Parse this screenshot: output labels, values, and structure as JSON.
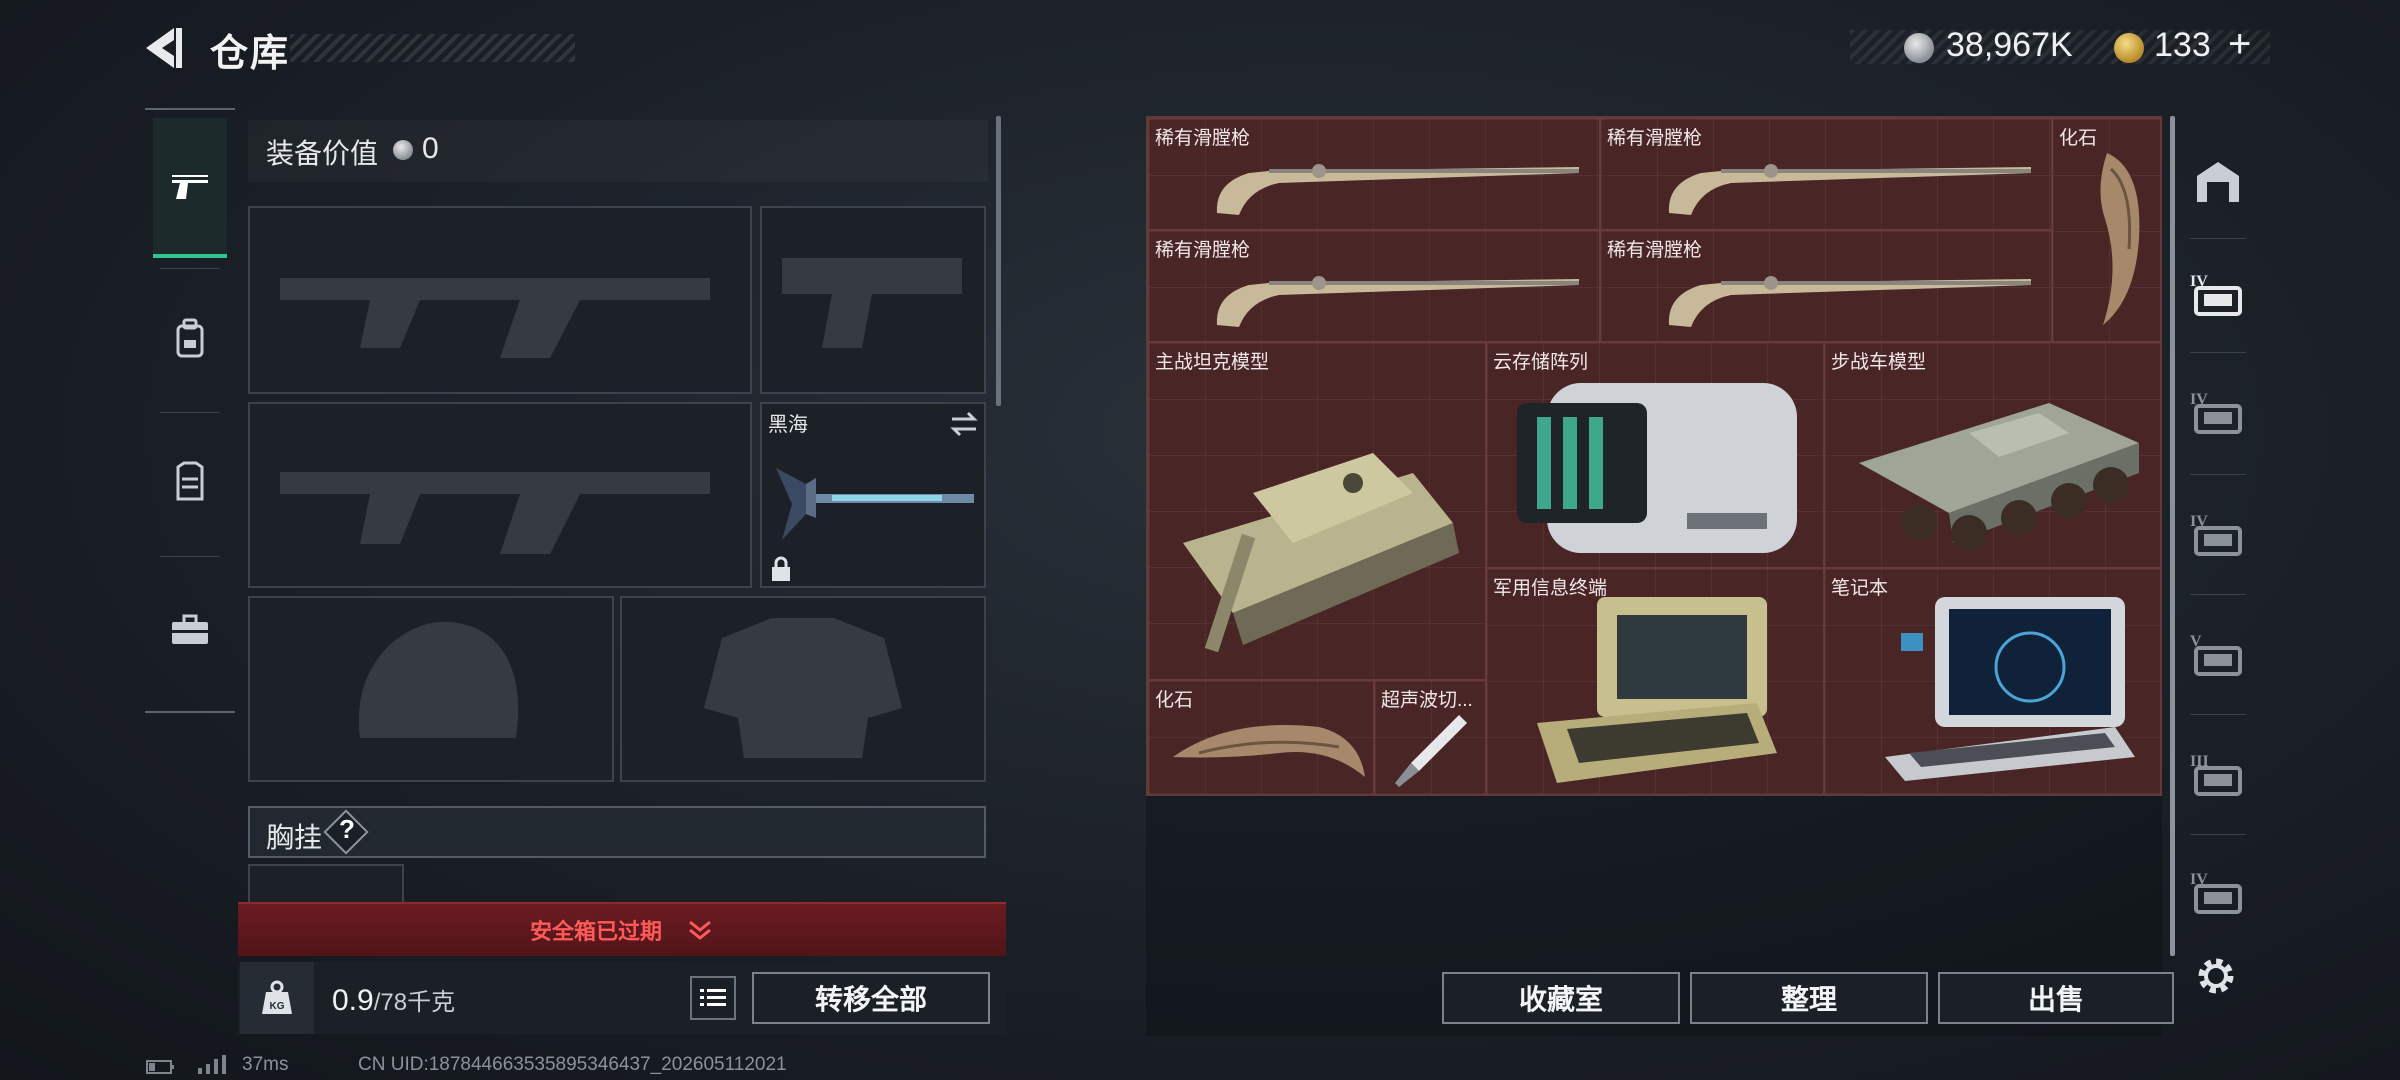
{
  "header": {
    "title": "仓库",
    "silver_currency": "38,967K",
    "gold_currency": "133",
    "add_label": "+"
  },
  "left_rail": {
    "items": [
      {
        "icon": "pistol-icon",
        "active": true
      },
      {
        "icon": "backpack-icon",
        "active": false
      },
      {
        "icon": "vest-icon",
        "active": false
      },
      {
        "icon": "toolbox-icon",
        "active": false
      }
    ]
  },
  "loadout": {
    "equip_value_label": "装备价值",
    "equip_value": "0",
    "melee_slot_label": "黑海",
    "chest_rig_label": "胸挂",
    "chest_rig_help": "?",
    "safebox_expired": "安全箱已过期",
    "weight_current": "0.9",
    "weight_max": "/78千克",
    "transfer_all": "转移全部"
  },
  "stash": {
    "items": [
      {
        "label": "稀有滑膛枪",
        "icon": "musket-icon"
      },
      {
        "label": "稀有滑膛枪",
        "icon": "musket-icon"
      },
      {
        "label": "化石",
        "icon": "claw-fossil-icon"
      },
      {
        "label": "稀有滑膛枪",
        "icon": "musket-icon"
      },
      {
        "label": "稀有滑膛枪",
        "icon": "musket-icon"
      },
      {
        "label": "主战坦克模型",
        "icon": "tank-model-icon"
      },
      {
        "label": "云存储阵列",
        "icon": "storage-array-icon"
      },
      {
        "label": "步战车模型",
        "icon": "ifv-model-icon"
      },
      {
        "label": "军用信息终端",
        "icon": "military-terminal-icon"
      },
      {
        "label": "笔记本",
        "icon": "laptop-icon"
      },
      {
        "label": "化石",
        "icon": "claw-fossil-icon"
      },
      {
        "label": "超声波切...",
        "icon": "ultrasonic-cutter-icon"
      }
    ],
    "buttons": {
      "collection": "收藏室",
      "organize": "整理",
      "sell": "出售"
    }
  },
  "right_rail": {
    "filters": [
      "IV",
      "IV",
      "IV",
      "V",
      "III",
      "IV"
    ]
  },
  "status": {
    "ping": "37ms",
    "uid": "CN UID:18784466353589534643​7_202605112021"
  },
  "colors": {
    "accent_green": "#2ec58e",
    "stash_bg": "#4a2526",
    "expired_red": "#ff5a5a"
  }
}
